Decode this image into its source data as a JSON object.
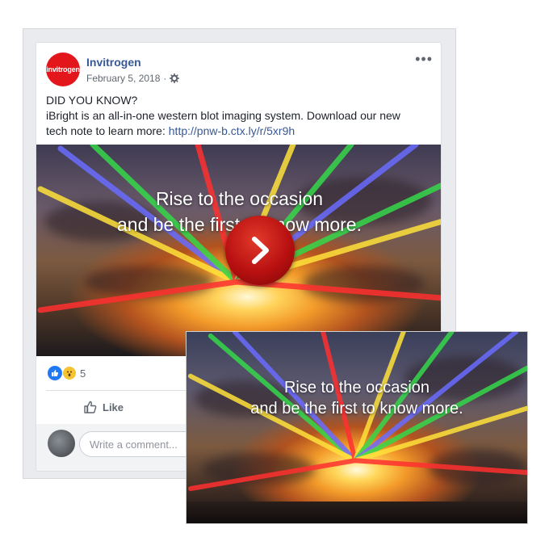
{
  "post": {
    "page_name": "Invitrogen",
    "logo_text": "invitrogen",
    "date": "February 5, 2018",
    "date_separator": "·",
    "more_label": "•••",
    "text_line1": "DID YOU KNOW?",
    "text_line2": "iBright is an all-in-one western blot imaging system. Download our new",
    "text_line3_prefix": "tech note to learn more:",
    "link": "http://pnw-b.ctx.ly/r/5xr9h"
  },
  "media": {
    "caption_line1": "Rise to the occasion",
    "caption_line2": "and be the first to know more."
  },
  "reactions": {
    "count": "5"
  },
  "actions": {
    "like_label": "Like"
  },
  "comment": {
    "placeholder": "Write a comment..."
  },
  "video": {
    "caption_line1": "Rise to the occasion",
    "caption_line2": "and be the first to know more."
  },
  "colors": {
    "brand": "#e3161b",
    "link": "#385898",
    "play": "#b81010"
  }
}
